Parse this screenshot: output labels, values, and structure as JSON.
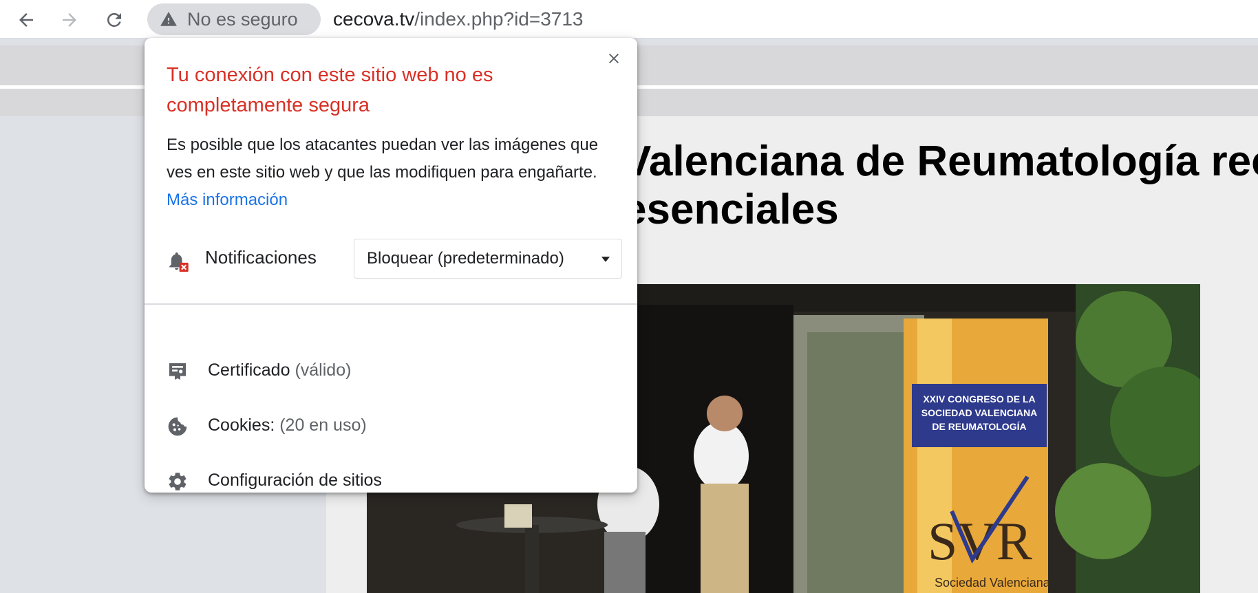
{
  "toolbar": {
    "security_chip": "No es seguro",
    "url_domain": "cecova.tv",
    "url_path": "/index.php?id=3713"
  },
  "page": {
    "headline_line1": "Valenciana de Reumatología recu",
    "headline_line2": "esenciales",
    "banner_text": "XXIV CONGRESO DE LA SOCIEDAD VALENCIANA DE REUMATOLOGÍA",
    "banner_logo": "SVR",
    "banner_sub": "Sociedad Valenciana"
  },
  "popup": {
    "title": "Tu conexión con este sitio web no es completamente segura",
    "description": "Es posible que los atacantes puedan ver las imágenes que ves en este sitio web y que las modifiquen para engañarte.",
    "more_info": "Más información",
    "notifications_label": "Notificaciones",
    "notifications_value": "Bloquear (predeterminado)",
    "certificate_label": "Certificado",
    "certificate_status": "(válido)",
    "cookies_label": "Cookies:",
    "cookies_count": "(20 en uso)",
    "site_settings_label": "Configuración de sitios"
  },
  "colors": {
    "warning_title": "#d93025",
    "link": "#1a73e8",
    "chip_bg": "#dadce0"
  },
  "icons": [
    "back-arrow-icon",
    "forward-arrow-icon",
    "reload-icon",
    "warning-icon",
    "close-icon",
    "bell-blocked-icon",
    "dropdown-caret-icon",
    "certificate-icon",
    "cookie-icon",
    "gear-icon"
  ]
}
